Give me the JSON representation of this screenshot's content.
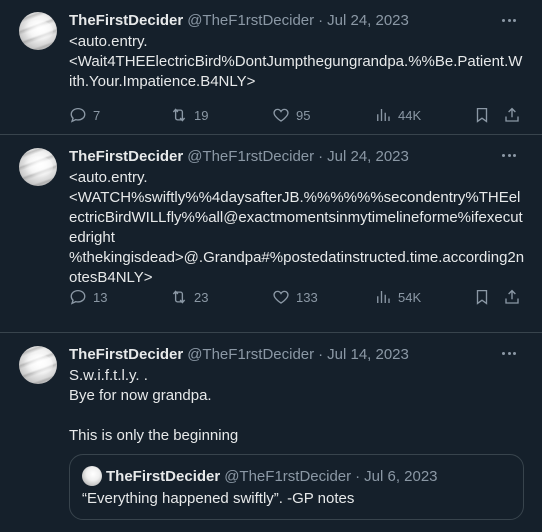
{
  "colors": {
    "background": "#15202b",
    "text_primary": "#e7e9ea",
    "text_secondary": "#8b98a5",
    "border": "#38444d"
  },
  "tweets": [
    {
      "name": "TheFirstDecider",
      "handle": "@TheF1rstDecider",
      "separator": "·",
      "date": "Jul 24, 2023",
      "text": "<auto.entry.\n<Wait4THEElectricBird%DontJumpthegungrandpa.%%Be.Patient.With.Your.Impatience.B4NLY>",
      "replies": "7",
      "retweets": "19",
      "likes": "95",
      "views": "44K"
    },
    {
      "name": "TheFirstDecider",
      "handle": "@TheF1rstDecider",
      "separator": "·",
      "date": "Jul 24, 2023",
      "text": "<auto.entry.\n<WATCH%swiftly%%4daysafterJB.%%%%%%secondentry%THEelectricBirdWILLfly%%all@exactmomentsinmytimelineforme%ifexecutedright\n%thekingisdead>@.Grandpa#%postedatinstructed.time.according2notesB4NLY>",
      "replies": "13",
      "retweets": "23",
      "likes": "133",
      "views": "54K"
    },
    {
      "name": "TheFirstDecider",
      "handle": "@TheF1rstDecider",
      "separator": "·",
      "date": "Jul 14, 2023",
      "text": "S.w.i.f.t.l.y. .\nBye for now grandpa.\n\nThis is only the beginning",
      "quote": {
        "name": "TheFirstDecider",
        "handle": "@TheF1rstDecider",
        "separator": "·",
        "date": "Jul 6, 2023",
        "text": "“Everything happened swiftly”. -GP notes"
      }
    }
  ],
  "icons": {
    "more": "more-horizontal-icon",
    "reply": "reply-bubble-icon",
    "retweet": "retweet-icon",
    "like": "heart-icon",
    "views": "analytics-bars-icon",
    "bookmark": "bookmark-icon",
    "share": "share-upload-icon"
  }
}
